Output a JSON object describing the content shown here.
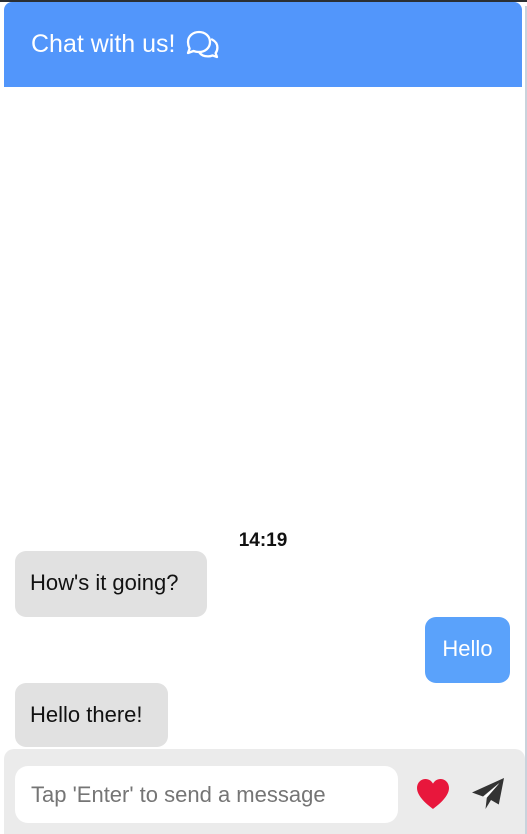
{
  "header": {
    "title": "Chat with us!",
    "icon": "chat-bubbles-icon",
    "color": "#5296fb"
  },
  "conversation": {
    "timestamp": "14:19",
    "messages": [
      {
        "sender": "agent",
        "text": "How's it going?"
      },
      {
        "sender": "user",
        "text": "Hello"
      },
      {
        "sender": "agent",
        "text": "Hello there!"
      }
    ]
  },
  "composer": {
    "placeholder": "Tap 'Enter' to send a message",
    "value": "",
    "heart_icon": "heart-icon",
    "heart_color": "#e8173c",
    "send_icon": "send-icon"
  }
}
